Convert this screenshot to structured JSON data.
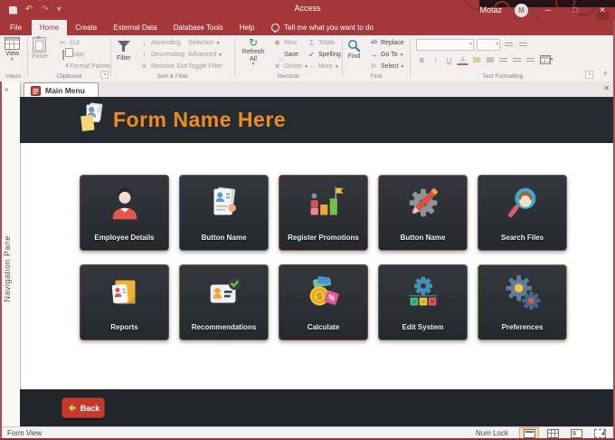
{
  "titlebar": {
    "app_title": "Access",
    "user_name": "Motaz",
    "avatar_initial": "M"
  },
  "ribbon": {
    "tabs": [
      {
        "label": "File",
        "selected": false
      },
      {
        "label": "Home",
        "selected": true
      },
      {
        "label": "Create",
        "selected": false
      },
      {
        "label": "External Data",
        "selected": false
      },
      {
        "label": "Database Tools",
        "selected": false
      },
      {
        "label": "Help",
        "selected": false
      }
    ],
    "tell_me": "Tell me what you want to do",
    "groups": {
      "views": {
        "label": "Views",
        "view_button": "View"
      },
      "clipboard": {
        "label": "Clipboard",
        "paste": "Paste",
        "cut": "Cut",
        "copy": "Copy",
        "format_painter": "Format Painter"
      },
      "sort_filter": {
        "label": "Sort & Filter",
        "filter": "Filter",
        "ascending": "Ascending",
        "descending": "Descending",
        "remove_sort": "Remove Sort",
        "selection": "Selection",
        "advanced": "Advanced",
        "toggle_filter": "Toggle Filter"
      },
      "records": {
        "label": "Records",
        "refresh_all": "Refresh All",
        "new": "New",
        "save": "Save",
        "delete": "Delete",
        "totals": "Totals",
        "spelling": "Spelling",
        "more": "More"
      },
      "find": {
        "label": "Find",
        "find": "Find",
        "replace": "Replace",
        "go_to": "Go To",
        "select": "Select"
      },
      "text_formatting": {
        "label": "Text Formatting"
      }
    }
  },
  "document_tabs": [
    {
      "label": "Main Menu",
      "active": true
    }
  ],
  "navigation_pane": {
    "label": "Navigation Pane"
  },
  "form": {
    "title": "Form Name Here",
    "back_label": "Back",
    "buttons": [
      {
        "label": "Employee Details",
        "icon": "person-icon"
      },
      {
        "label": "Button Name",
        "icon": "resume-document-icon"
      },
      {
        "label": "Register Promotions",
        "icon": "bar-chart-flag-icon"
      },
      {
        "label": "Button Name",
        "icon": "gear-pencil-icon"
      },
      {
        "label": "Search Files",
        "icon": "magnifier-person-icon"
      },
      {
        "label": "Reports",
        "icon": "folder-id-card-icon"
      },
      {
        "label": "Recommendations",
        "icon": "id-card-check-icon"
      },
      {
        "label": "Calculate",
        "icon": "coin-percent-icon"
      },
      {
        "label": "Edit System",
        "icon": "gear-squares-icon"
      },
      {
        "label": "Preferences",
        "icon": "two-gears-icon"
      }
    ]
  },
  "status_bar": {
    "left_text": "Form View",
    "num_lock": "Num Lock"
  },
  "colors": {
    "titlebar": "#A4373A",
    "accent_orange": "#EE8C21",
    "form_dark": "#252B31",
    "tile_bg": "#2E3237",
    "back_button": "#C13A2C"
  },
  "icons": {
    "caret": "▾",
    "close": "✕",
    "minimize": "─",
    "maximize": "□",
    "undo": "↶",
    "redo": "↷",
    "nav_expand": "»",
    "ribbon_collapse": "∧",
    "scissors": "✂",
    "sigma": "Σ",
    "check": "✓",
    "sort_asc": "↓",
    "sort_desc": "↑",
    "remove_x": "✕",
    "refresh": "↻",
    "asterisk": "✱",
    "dots": "⋯",
    "dialog_launcher": "↘",
    "doc_close": "✕",
    "bold": "B",
    "italic": "I",
    "underline": "U",
    "arrow_go": "→",
    "select_arrow": "▷"
  }
}
